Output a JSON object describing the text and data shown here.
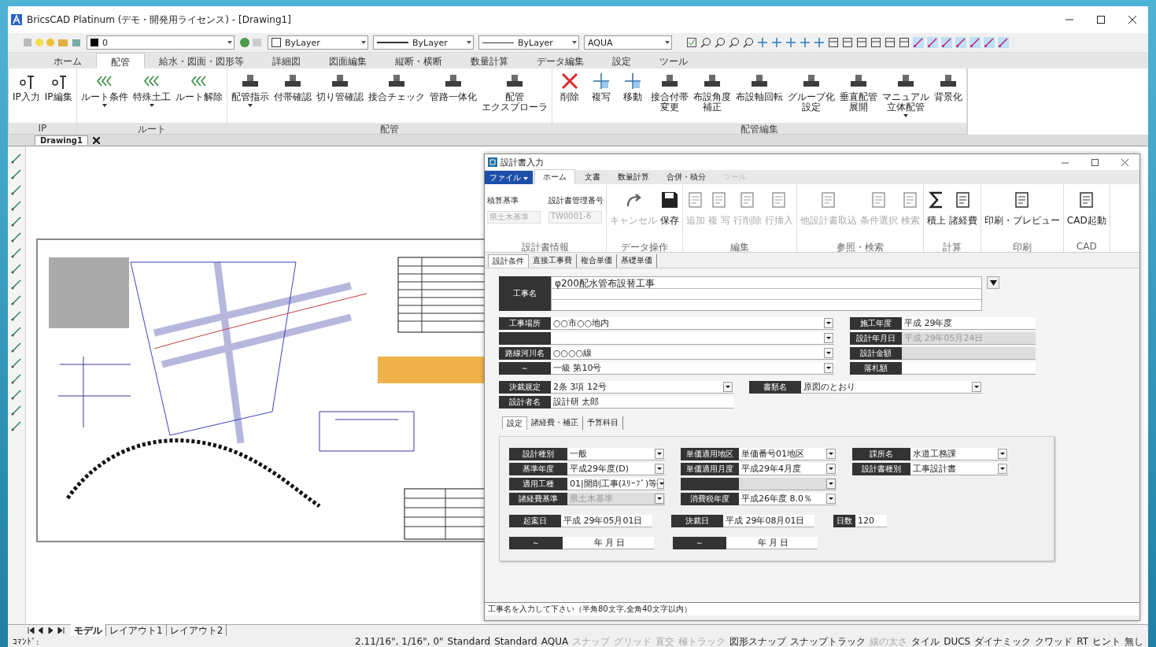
{
  "window": {
    "title": "BricsCAD Platinum (デモ・開発用ライセンス) - [Drawing1]"
  },
  "toolbar": {
    "layer": "0",
    "color_mode": "ByLayer",
    "linetype": "ByLayer",
    "lineweight": "ByLayer",
    "plot_style": "AQUA"
  },
  "ribbon_tabs": [
    {
      "label": "ホーム",
      "selected": false
    },
    {
      "label": "配管",
      "selected": true
    },
    {
      "label": "給水・図面・図形等",
      "selected": false
    },
    {
      "label": "詳細図",
      "selected": false
    },
    {
      "label": "図面編集",
      "selected": false
    },
    {
      "label": "縦断・横断",
      "selected": false
    },
    {
      "label": "数量計算",
      "selected": false
    },
    {
      "label": "データ編集",
      "selected": false
    },
    {
      "label": "設定",
      "selected": false
    },
    {
      "label": "ツール",
      "selected": false
    }
  ],
  "ribbon_groups": [
    {
      "title": "IP",
      "buttons": [
        {
          "lines": [
            "IP入力"
          ],
          "dropdown": false
        },
        {
          "lines": [
            "IP編集"
          ],
          "dropdown": false
        }
      ]
    },
    {
      "title": "ルート",
      "buttons": [
        {
          "lines": [
            "ルート条件"
          ],
          "dropdown": true
        },
        {
          "lines": [
            "特殊土工"
          ],
          "dropdown": true
        },
        {
          "lines": [
            "ルート解除"
          ],
          "dropdown": false
        }
      ]
    },
    {
      "title": "配管",
      "buttons": [
        {
          "lines": [
            "配管指示"
          ],
          "dropdown": true
        },
        {
          "lines": [
            "付帯確認"
          ],
          "dropdown": false
        },
        {
          "lines": [
            "切り管確認"
          ],
          "dropdown": false
        },
        {
          "lines": [
            "接合チェック"
          ],
          "dropdown": false
        },
        {
          "lines": [
            "管路一体化"
          ],
          "dropdown": false
        },
        {
          "lines": [
            "配管",
            "エクスプローラ"
          ],
          "dropdown": false
        }
      ]
    },
    {
      "title": "配管編集",
      "buttons": [
        {
          "lines": [
            "削除"
          ],
          "dropdown": false
        },
        {
          "lines": [
            "複写"
          ],
          "dropdown": false
        },
        {
          "lines": [
            "移動"
          ],
          "dropdown": false
        },
        {
          "lines": [
            "接合付帯",
            "変更"
          ],
          "dropdown": false
        },
        {
          "lines": [
            "布設角度",
            "補正"
          ],
          "dropdown": false
        },
        {
          "lines": [
            "布設軸回転"
          ],
          "dropdown": false
        },
        {
          "lines": [
            "グループ化",
            "設定"
          ],
          "dropdown": false
        },
        {
          "lines": [
            "垂直配管",
            "展開"
          ],
          "dropdown": false
        },
        {
          "lines": [
            "マニュアル",
            "立体配管"
          ],
          "dropdown": true
        },
        {
          "lines": [
            "背景化"
          ],
          "dropdown": false
        }
      ]
    }
  ],
  "document_tabs": [
    {
      "label": "Drawing1",
      "selected": true
    }
  ],
  "layout_tabs": [
    {
      "label": "モデル",
      "selected": true
    },
    {
      "label": "レイアウト1",
      "selected": false
    },
    {
      "label": "レイアウト2",
      "selected": false
    }
  ],
  "command_line": {
    "prompt": "ｺﾏﾝﾄﾞ:"
  },
  "status_bar": {
    "coordinates": "2.11/16\", 1/16\", 0\"",
    "items": [
      {
        "label": "Standard",
        "on": true
      },
      {
        "label": "Standard",
        "on": true
      },
      {
        "label": "AQUA",
        "on": true
      },
      {
        "label": "スナップ",
        "on": false
      },
      {
        "label": "グリッド",
        "on": false
      },
      {
        "label": "直交",
        "on": false
      },
      {
        "label": "極トラック",
        "on": false
      },
      {
        "label": "図形スナップ",
        "on": true
      },
      {
        "label": "スナップトラック",
        "on": true
      },
      {
        "label": "線の太さ",
        "on": false
      },
      {
        "label": "タイル",
        "on": true
      },
      {
        "label": "DUCS",
        "on": true
      },
      {
        "label": "ダイナミック",
        "on": true
      },
      {
        "label": "クワッド",
        "on": true
      },
      {
        "label": "RT",
        "on": true
      },
      {
        "label": "ヒント",
        "on": true
      },
      {
        "label": "無し",
        "on": true
      }
    ]
  },
  "dialog": {
    "title": "設計書入力",
    "file_menu": "ファイル",
    "tabs": [
      {
        "label": "ホーム",
        "selected": true,
        "disabled": false
      },
      {
        "label": "文書",
        "selected": false,
        "disabled": false
      },
      {
        "label": "数量計算",
        "selected": false,
        "disabled": false
      },
      {
        "label": "合併・積分",
        "selected": false,
        "disabled": false
      },
      {
        "label": "ツール",
        "selected": false,
        "disabled": true
      }
    ],
    "info_group": {
      "title": "設計書情報",
      "fields": [
        {
          "label": "積算基準",
          "value": "県土木基準",
          "disabled": true
        },
        {
          "label": "設計書管理番号",
          "value": "TW0001-6",
          "disabled": true
        }
      ]
    },
    "groups": [
      {
        "title": "データ操作",
        "buttons": [
          {
            "label": "キャンセル",
            "disabled": true
          },
          {
            "label": "保存",
            "disabled": false
          }
        ]
      },
      {
        "title": "編集",
        "buttons": [
          {
            "label": "追加",
            "disabled": true
          },
          {
            "label": "複 写",
            "disabled": true
          },
          {
            "label": "行削除",
            "disabled": true
          },
          {
            "label": "行挿入",
            "disabled": true
          }
        ]
      },
      {
        "title": "参照・検索",
        "buttons": [
          {
            "label": "他設計書取込",
            "disabled": true
          },
          {
            "label": "条件選択",
            "disabled": true
          },
          {
            "label": "検索",
            "disabled": true
          }
        ]
      },
      {
        "title": "計算",
        "buttons": [
          {
            "label": "積上",
            "disabled": false
          },
          {
            "label": "諸経費",
            "disabled": false
          }
        ]
      },
      {
        "title": "印刷",
        "buttons": [
          {
            "label": "印刷・プレビュー",
            "disabled": false
          }
        ]
      },
      {
        "title": "CAD",
        "buttons": [
          {
            "label": "CAD起動",
            "disabled": false
          }
        ]
      }
    ],
    "form_tabs": [
      {
        "label": "設計条件",
        "selected": true
      },
      {
        "label": "直接工事費",
        "selected": false
      },
      {
        "label": "複合単価",
        "selected": false
      },
      {
        "label": "基礎単価",
        "selected": false
      }
    ],
    "project_name": {
      "label": "工事名",
      "value": "φ200配水管布設替工事"
    },
    "location_fields": [
      {
        "label": "工事場所",
        "value": "○○市○○地内",
        "dropdown": true
      },
      {
        "dropdown": true
      },
      {
        "label": "路線河川名",
        "value": "○○○○線",
        "dropdown": true
      },
      {
        "label": "～",
        "value": "一級 第10号",
        "dropdown": true
      }
    ],
    "year_fields": [
      {
        "label": "施工年度",
        "value": "平成 29年度",
        "disabled": false
      },
      {
        "label": "設計年月日",
        "value": "平成 29年05月24日",
        "disabled": true
      },
      {
        "label": "設計金額",
        "disabled": true
      },
      {
        "label": "落札額",
        "disabled": false
      }
    ],
    "approval_fields": [
      {
        "label": "決裁規定",
        "value": "2条 3項 12号",
        "dropdown": true
      },
      {
        "label": "設計者名",
        "value": "設計研 太郎",
        "dropdown": false
      }
    ],
    "document_field": {
      "label": "書類名",
      "value": "原図のとおり"
    },
    "sub_tabs": [
      {
        "label": "設定",
        "selected": true
      },
      {
        "label": "諸経費・補正",
        "selected": false
      },
      {
        "label": "予算科目",
        "selected": false
      }
    ],
    "settings_columns": [
      [
        {
          "label": "設計種別",
          "value": "一般",
          "disabled": false
        },
        {
          "label": "基準年度",
          "value": "平成29年度(D)",
          "disabled": false
        },
        {
          "label": "適用工種",
          "value": "01|開削工事(ｽﾘｰﾌﾞ)等",
          "disabled": false
        },
        {
          "label": "諸経費基準",
          "value": "県土木基準",
          "disabled": true
        }
      ],
      [
        {
          "label": "単価適用地区",
          "value": "単価番号01地区",
          "disabled": false
        },
        {
          "label": "単価適用月度",
          "value": "平成29年4月度",
          "disabled": false
        },
        {
          "disabled": true
        },
        {
          "label": "消費税年度",
          "value": "平成26年度 8.0％",
          "disabled": false
        }
      ],
      [
        {
          "label": "課所名",
          "value": "水道工務課",
          "disabled": false
        },
        {
          "label": "設計書種別",
          "value": "工事設計書",
          "disabled": false
        }
      ]
    ],
    "dates": [
      {
        "label": "起案日",
        "value": "平成 29年05月01日"
      },
      {
        "label": "決裁日",
        "value": "平成 29年08月01日"
      },
      {
        "label": "日数",
        "value": "120"
      }
    ],
    "period": [
      {
        "label": "～",
        "value": "年 月 日"
      },
      {
        "label": "～",
        "value": "年 月 日"
      }
    ],
    "message": "工事名を入力して下さい（半角80文字,全角40文字以内）"
  }
}
